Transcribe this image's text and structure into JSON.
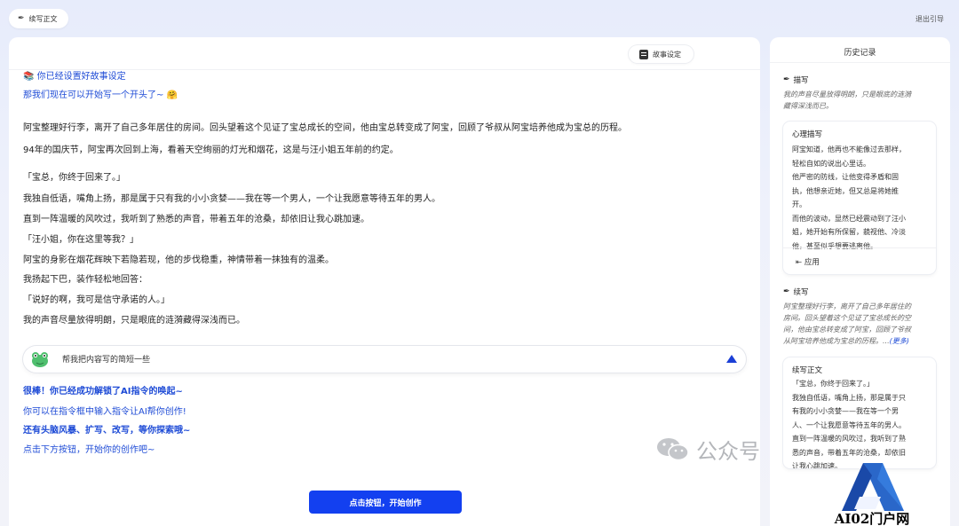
{
  "topbar": {
    "continue_label": "续写正文",
    "exit_label": "退出引导"
  },
  "main": {
    "story_setting_label": "故事设定",
    "intro1": "📚 你已经设置好故事设定",
    "intro2": "那我们现在可以开始写一个开头了~ 🤗",
    "story_lines": [
      "阿宝整理好行李，离开了自己多年居住的房间。回头望着这个见证了宝总成长的空间，他由宝总转变成了阿宝，回顾了爷叔从阿宝培养他成为宝总的历程。",
      "94年的国庆节，阿宝再次回到上海，看着天空绚丽的灯光和烟花，这是与汪小姐五年前的约定。",
      "「宝总，你终于回来了。」",
      "我独自低语，嘴角上扬，那是属于只有我的小小贪婪——我在等一个男人，一个让我愿意等待五年的男人。",
      "直到一阵温暖的风吹过，我听到了熟悉的声音，带着五年的沧桑，却依旧让我心跳加速。",
      "「汪小姐，你在这里等我？」",
      "阿宝的身影在烟花辉映下若隐若现，他的步伐稳重，神情带着一抹独有的温柔。",
      "我扬起下巴，装作轻松地回答：",
      "「说好的啊，我可是信守承诺的人。」",
      "我的声音尽量放得明朗，只是眼底的涟漪藏得深浅而已。"
    ],
    "prompt_text": "帮我把内容写的简短一些",
    "tips": [
      "很棒！你已经成功解锁了AI指令的唤起~",
      "你可以在指令框中输入指令让AI帮你创作!",
      "还有头脑风暴、扩写、改写，等你探索哦~",
      "点击下方按钮，开始你的创作吧~"
    ],
    "start_button": "点击按钮，开始创作",
    "watermark": "公众号"
  },
  "history": {
    "title": "历史记录",
    "describe": {
      "heading": "描写",
      "summary_lines": [
        "我的声音尽量放得明朗，只是眼底的涟漪",
        "藏得深浅而已。"
      ],
      "card_title": "心理描写",
      "card_lines": [
        "阿宝知道，他再也不能像过去那样，",
        "轻松自如的说出心里话。",
        "他严密的防线，让他变得矛盾和固",
        "执，他想亲近她，但又总是将她推",
        "开。",
        "而他的波动，显然已经震动到了汪小",
        "姐，她开始有所保留，藐视他、冷淡",
        "他，甚至似乎想要逃离他。"
      ],
      "apply_label": "应用"
    },
    "continue": {
      "heading": "续写",
      "summary_lines": [
        "阿宝整理好行李，离开了自己多年居住的",
        "房间。回头望着这个见证了宝总成长的空",
        "间，他由宝总转变成了阿宝，回顾了爷叔",
        "从阿宝培养他成为宝总的历程。..."
      ],
      "more_label": "(更多)",
      "card_title": "续写正文",
      "card_lines": [
        "「宝总，你终于回来了。」",
        "我独自低语，嘴角上扬，那是属于只",
        "有我的小小贪婪——我在等一个男",
        "人、一个让我愿意等待五年的男人。",
        "直到一阵温暖的风吹过，我听到了熟",
        "悉的声音，带着五年的沧桑，却依旧",
        "让我心跳加速。"
      ]
    }
  },
  "logo": {
    "text": "AI02门户网"
  },
  "colors": {
    "accent": "#1340f0",
    "link": "#1e4bd6"
  }
}
